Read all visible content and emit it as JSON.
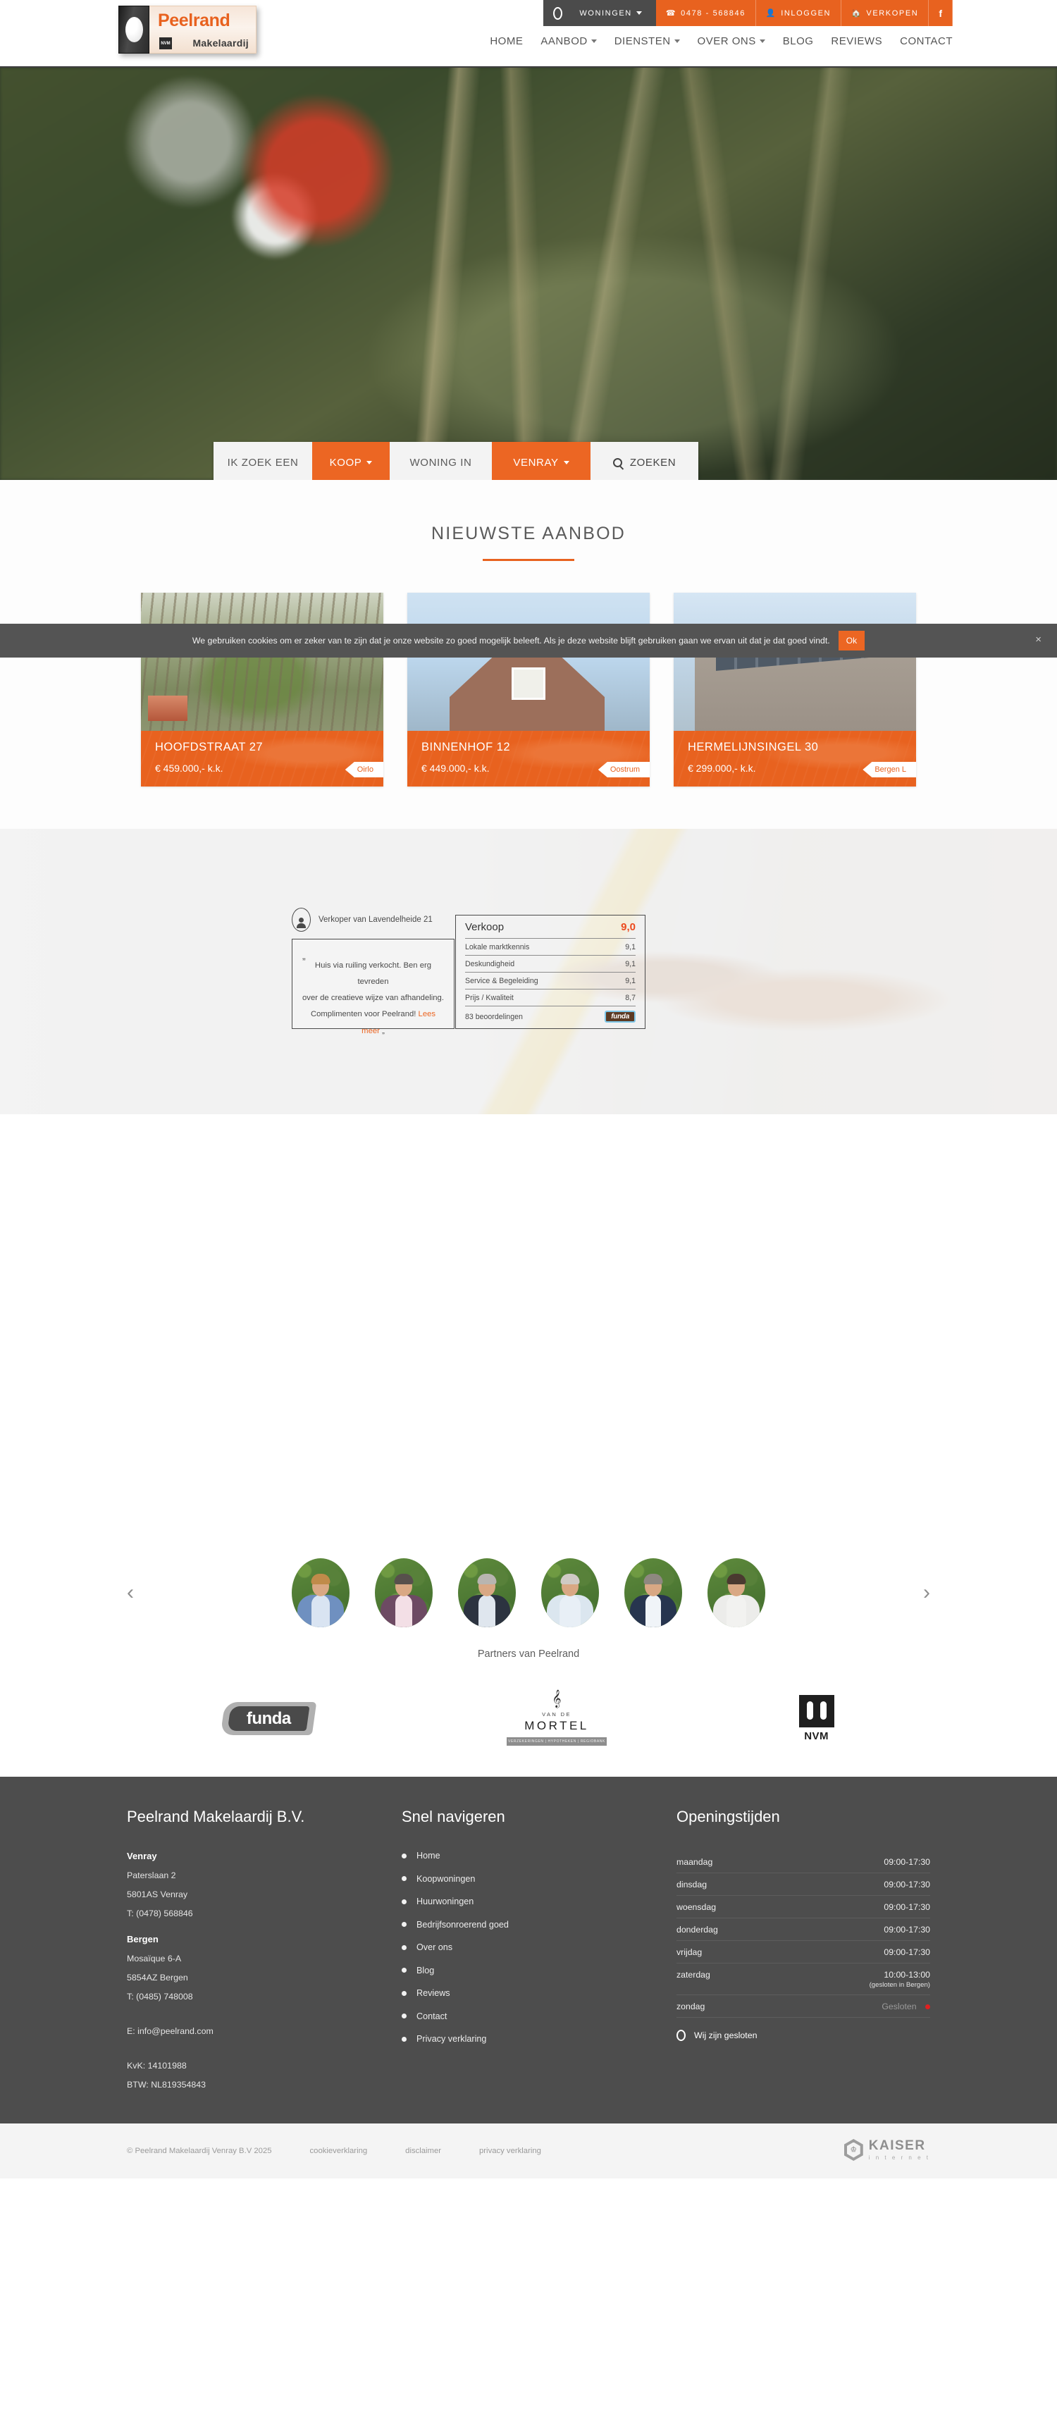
{
  "header": {
    "logo": {
      "name": "Peelrand",
      "sub": "Makelaardij",
      "nvm": "NVM"
    },
    "topbar": [
      {
        "label": "WONINGEN",
        "icon": "oval-logo-icon",
        "caret": true,
        "style": "dark"
      },
      {
        "label": "0478 - 568846",
        "icon": "phone-icon",
        "style": "accent"
      },
      {
        "label": "INLOGGEN",
        "icon": "user-icon",
        "style": "accent"
      },
      {
        "label": "VERKOPEN",
        "icon": "home-icon",
        "style": "accent"
      },
      {
        "label": "f",
        "icon": "facebook-icon",
        "style": "accent"
      }
    ],
    "nav": [
      {
        "label": "HOME",
        "caret": false
      },
      {
        "label": "AANBOD",
        "caret": true
      },
      {
        "label": "DIENSTEN",
        "caret": true
      },
      {
        "label": "OVER ONS",
        "caret": true
      },
      {
        "label": "BLOG",
        "caret": false
      },
      {
        "label": "REVIEWS",
        "caret": false
      },
      {
        "label": "CONTACT",
        "caret": false
      }
    ]
  },
  "hero": {
    "search": {
      "label": "IK ZOEK EEN",
      "type": "KOOP",
      "mid": "WONING IN",
      "place": "VENRAY",
      "button": "ZOEKEN"
    }
  },
  "cookie": {
    "text": "We gebruiken cookies om er zeker van te zijn dat je onze website zo goed mogelijk beleeft. Als je deze website blijft gebruiken gaan we ervan uit dat je dat goed vindt.",
    "ok": "Ok",
    "close": "×"
  },
  "aanbod": {
    "title": "NIEUWSTE AANBOD",
    "cards": [
      {
        "address": "HOOFDSTRAAT 27",
        "price": "€ 459.000,- k.k.",
        "tag": "Oirlo"
      },
      {
        "address": "BINNENHOF 12",
        "price": "€ 449.000,- k.k.",
        "tag": "Oostrum"
      },
      {
        "address": "HERMELIJNSINGEL 30",
        "price": "€ 299.000,- k.k.",
        "tag": "Bergen L"
      }
    ]
  },
  "review": {
    "who": "Verkoper van Lavendelheide 21",
    "quote_open": "„",
    "quote_close": "„",
    "quote_line1": "Huis via ruiling verkocht. Ben erg tevreden",
    "quote_line2": "over de creatieve wijze van afhandeling.",
    "quote_line3": "Complimenten voor Peelrand!",
    "read_more": "Lees meer",
    "score_title": "Verkoop",
    "score_value": "9,0",
    "rows": [
      {
        "label": "Lokale marktkennis",
        "value": "9,1"
      },
      {
        "label": "Deskundigheid",
        "value": "9,1"
      },
      {
        "label": "Service & Begeleiding",
        "value": "9,1"
      },
      {
        "label": "Prijs / Kwaliteit",
        "value": "8,7"
      }
    ],
    "count": "83 beoordelingen",
    "badge": "funda"
  },
  "team": {
    "prev": "‹",
    "next": "›",
    "members": [
      {
        "name": "team-member-1",
        "shirt": "#d9e4f2",
        "jacket": "#6f90c0",
        "hair": "#c08b4a"
      },
      {
        "name": "team-member-2",
        "shirt": "#f3dfe6",
        "jacket": "#6d4a63",
        "hair": "#57504c"
      },
      {
        "name": "team-member-3",
        "shirt": "#dfe6ee",
        "jacket": "#2c3340",
        "hair": "#b8b5b0"
      },
      {
        "name": "team-member-4",
        "shirt": "#e8eff6",
        "jacket": "#dbe6ef",
        "hair": "#cfcac4"
      },
      {
        "name": "team-member-5",
        "shirt": "#f0f4f8",
        "jacket": "#27354f",
        "hair": "#8e8880"
      },
      {
        "name": "team-member-6",
        "shirt": "#f2f2f0",
        "jacket": "#ececea",
        "hair": "#4a3a30"
      }
    ]
  },
  "partners": {
    "title": "Partners van Peelrand",
    "items": [
      {
        "name": "funda",
        "type": "funda"
      },
      {
        "name": "Van de Mortel",
        "type": "mortel",
        "eyebrow": "VAN DE",
        "label": "MORTEL",
        "bar": "VERZEKERINGEN  |  HYPOTHEKEN  |  REGIOBANK"
      },
      {
        "name": "NVM",
        "type": "nvm",
        "label": "NVM"
      }
    ]
  },
  "footer": {
    "company": {
      "heading": "Peelrand Makelaardij B.V.",
      "offices": [
        {
          "city": "Venray",
          "street": "Paterslaan 2",
          "zip": "5801AS Venray",
          "phone": "T: (0478) 568846"
        },
        {
          "city": "Bergen",
          "street": "Mosaïque 6-A",
          "zip": "5854AZ Bergen",
          "phone": "T: (0485) 748008"
        }
      ],
      "email": "E: info@peelrand.com",
      "kvk": "KvK: 14101988",
      "btw": "BTW: NL819354843"
    },
    "nav": {
      "heading": "Snel navigeren",
      "items": [
        "Home",
        "Koopwoningen",
        "Huurwoningen",
        "Bedrijfsonroerend goed",
        "Over ons",
        "Blog",
        "Reviews",
        "Contact",
        "Privacy verklaring"
      ]
    },
    "hours": {
      "heading": "Openingstijden",
      "rows": [
        {
          "day": "maandag",
          "time": "09:00-17:30",
          "note": "",
          "closed": false
        },
        {
          "day": "dinsdag",
          "time": "09:00-17:30",
          "note": "",
          "closed": false
        },
        {
          "day": "woensdag",
          "time": "09:00-17:30",
          "note": "",
          "closed": false
        },
        {
          "day": "donderdag",
          "time": "09:00-17:30",
          "note": "",
          "closed": false
        },
        {
          "day": "vrijdag",
          "time": "09:00-17:30",
          "note": "",
          "closed": false
        },
        {
          "day": "zaterdag",
          "time": "10:00-13:00",
          "note": "(gesloten in Bergen)",
          "closed": false
        },
        {
          "day": "zondag",
          "time": "Gesloten",
          "note": "",
          "closed": true
        }
      ],
      "status": "Wij zijn gesloten"
    }
  },
  "bottom": {
    "copyright": "© Peelrand Makelaardij Venray B.V 2025",
    "links": [
      "cookieverklaring",
      "disclaimer",
      "privacy verklaring"
    ],
    "kaiser": {
      "name": "KAISER",
      "sub": "i n t e r n e t"
    }
  },
  "colors": {
    "accent": "#e8621f",
    "accent_light": "#ec6623",
    "dark": "#4b4b4b",
    "footer_bg": "#4d4d4d",
    "score": "#ec4a1f"
  }
}
